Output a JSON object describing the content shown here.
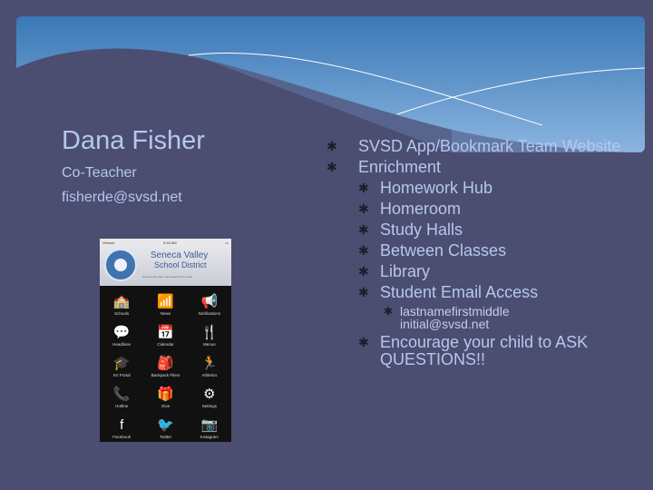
{
  "banner": {
    "colors": {
      "top": "#3a78b6",
      "bottom": "#8ab4df",
      "background": "#4b4d71"
    }
  },
  "contact": {
    "name": "Dana Fisher",
    "role": "Co-Teacher",
    "email": "fisherde@svsd.net"
  },
  "phone": {
    "carrier": "Verizon",
    "time": "9:26 AM",
    "brand_line1": "Seneca Valley",
    "brand_line2": "School District",
    "tagline": "Proud of the past, committed to the future",
    "apps": [
      {
        "label": "Schools",
        "icon": "🏫"
      },
      {
        "label": "News",
        "icon": "📶"
      },
      {
        "label": "Notifications",
        "icon": "📢"
      },
      {
        "label": "Headlines",
        "icon": "💬"
      },
      {
        "label": "Calendar",
        "icon": "📅"
      },
      {
        "label": "Menus",
        "icon": "🍴"
      },
      {
        "label": "SV Portal",
        "icon": "🎓"
      },
      {
        "label": "Backpack Fliers",
        "icon": "🎒"
      },
      {
        "label": "Athletics",
        "icon": "🏃"
      },
      {
        "label": "Hotline",
        "icon": "📞"
      },
      {
        "label": "Give",
        "icon": "🎁"
      },
      {
        "label": "Settings",
        "icon": "⚙"
      },
      {
        "label": "Facebook",
        "icon": "f"
      },
      {
        "label": "Twitter",
        "icon": "🐦"
      },
      {
        "label": "Instagram",
        "icon": "📷"
      }
    ]
  },
  "bullets": {
    "bullet_icon": "✱",
    "items": [
      {
        "level": 1,
        "text": "SVSD App/Bookmark Team Website"
      },
      {
        "level": 1,
        "text": "Enrichment"
      },
      {
        "level": 2,
        "text": "Homework Hub"
      },
      {
        "level": 2,
        "text": "Homeroom"
      },
      {
        "level": 2,
        "text": "Study Halls"
      },
      {
        "level": 2,
        "text": "Between Classes"
      },
      {
        "level": 2,
        "text": "Library"
      },
      {
        "level": 2,
        "text": "Student Email Access"
      },
      {
        "level": 3,
        "text": "lastnamefirstmiddle initial@svsd.net"
      },
      {
        "level": 2,
        "text": "Encourage your child to ASK QUESTIONS!!"
      }
    ]
  }
}
